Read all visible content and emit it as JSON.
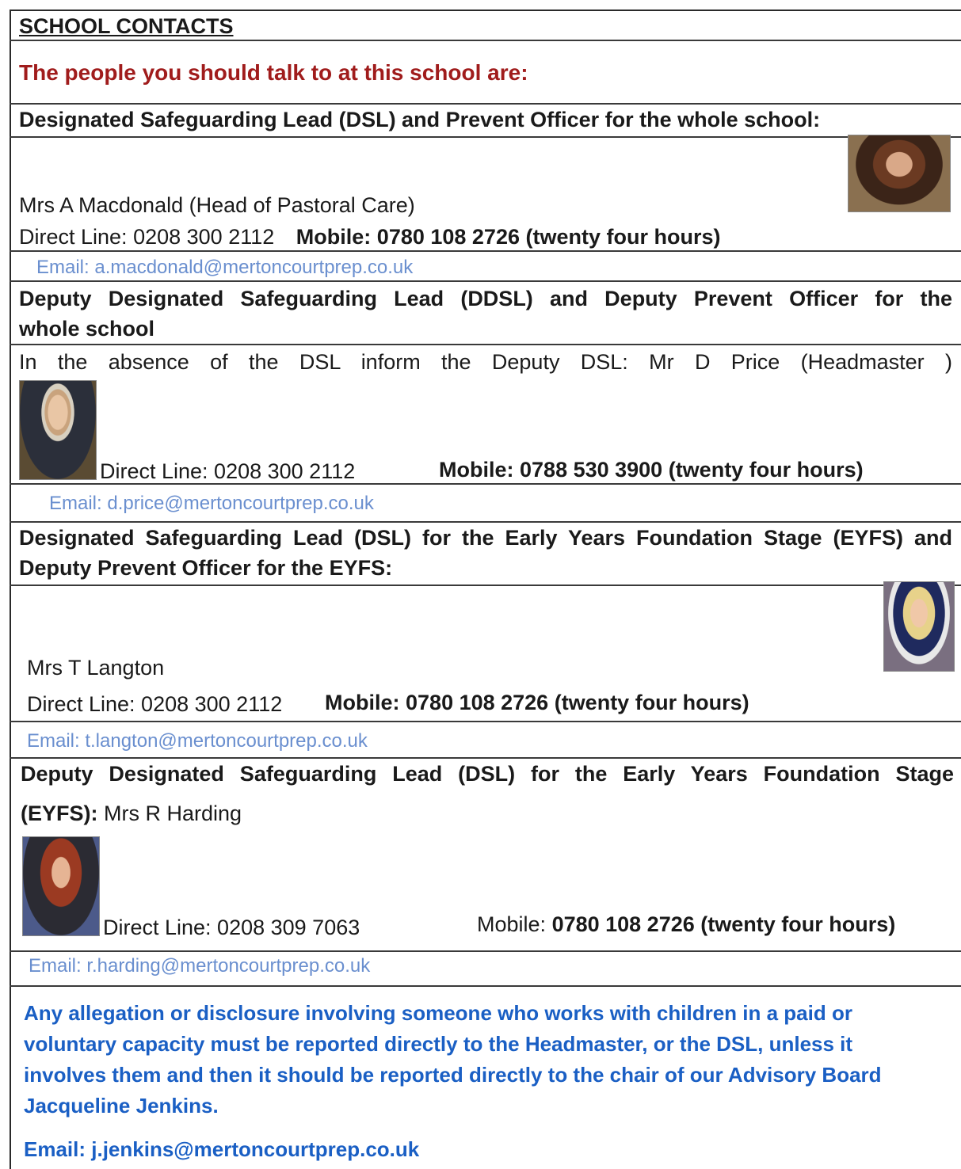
{
  "title": "SCHOOL CONTACTS",
  "intro": "The people you should talk to at this school are:",
  "dsl": {
    "heading": "Designated Safeguarding Lead (DSL) and Prevent Officer for the whole school:",
    "name": "Mrs A Macdonald (Head of Pastoral Care)",
    "direct_label": "Direct Line:",
    "direct": "0208 300 2112",
    "mobile_label": "Mobile:",
    "mobile": "0780 108 2726 (twenty four hours)",
    "email": "Email: a.macdonald@mertoncourtprep.co.uk"
  },
  "ddsl": {
    "heading_line1": "Deputy Designated Safeguarding Lead (DDSL) and Deputy Prevent Officer for the",
    "heading_line2": "whole school",
    "info": "In the absence of the DSL inform the Deputy DSL: Mr D Price (Headmaster )",
    "direct": "Direct Line: 0208 300 2112",
    "mobile_label": "Mobile:",
    "mobile": "0788 530 3900 (twenty four hours)",
    "email": "Email: d.price@mertoncourtprep.co.uk"
  },
  "eyfs_dsl": {
    "heading_line1": "Designated Safeguarding Lead (DSL) for the Early Years Foundation Stage (EYFS) and",
    "heading_line2": "Deputy Prevent Officer for the EYFS:",
    "name": "Mrs T Langton",
    "direct": "Direct Line: 0208 300 2112",
    "mobile_label": "Mobile:",
    "mobile": "0780 108 2726 (twenty four hours)",
    "email": "Email: t.langton@mertoncourtprep.co.uk"
  },
  "eyfs_ddsl": {
    "heading_line1": "Deputy Designated Safeguarding Lead (DSL) for the Early Years Foundation Stage",
    "heading_prefix": "(EYFS):",
    "heading_name": "Mrs R Harding",
    "direct": "Direct Line: 0208 309 7063",
    "mobile_label": "Mobile:",
    "mobile": "0780 108 2726 (twenty four hours)",
    "email": "Email: r.harding@mertoncourtprep.co.uk"
  },
  "allegation": {
    "line1": "Any allegation or disclosure involving someone who works with children in a paid or",
    "line2": "voluntary capacity must be reported directly to the Headmaster, or the DSL, unless it",
    "line3": "involves them and then it should be reported directly to the chair of our Advisory Board",
    "line4": "Jacqueline Jenkins.",
    "email": "Email: j.jenkins@mertoncourtprep.co.uk"
  }
}
